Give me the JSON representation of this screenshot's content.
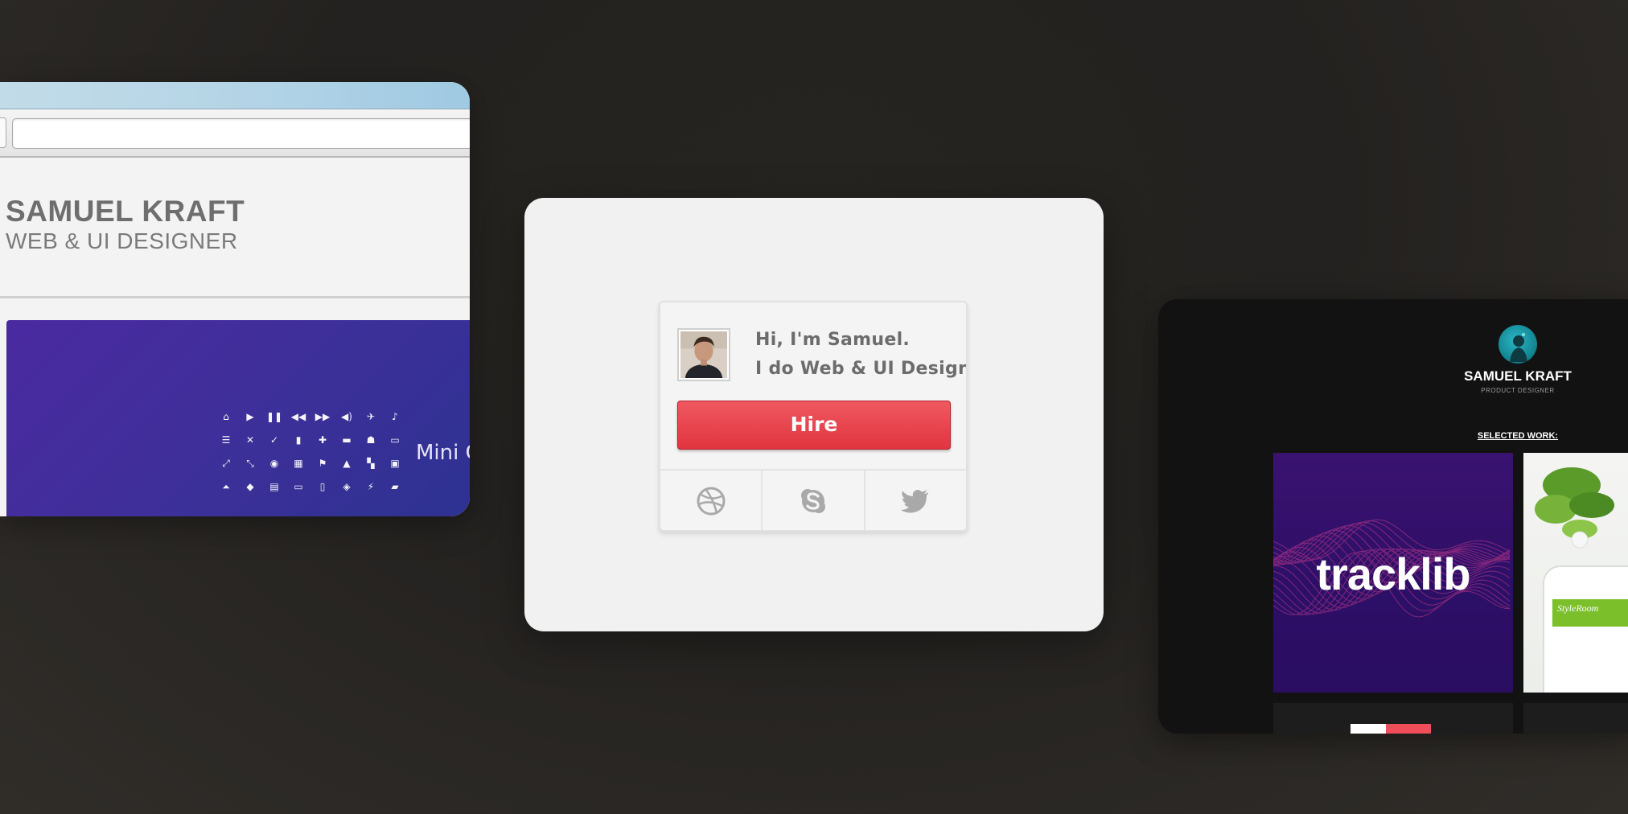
{
  "left_browser": {
    "name": "SAMUEL KRAFT",
    "role": "WEB & UI DESIGNER",
    "banner_label": "Mini G",
    "icons": [
      "⌂",
      "▶",
      "❚❚",
      "◀◀",
      "▶▶",
      "◀)",
      "✈",
      "♪",
      "☰",
      "✕",
      "✓",
      "▮",
      "✚",
      "▬",
      "☗",
      "▭",
      "⤢",
      "⤡",
      "◉",
      "▦",
      "⚑",
      "▲",
      "▚",
      "▣",
      "⏶",
      "◆",
      "▤",
      "▭",
      "▯",
      "◈",
      "⚡",
      "▰"
    ]
  },
  "widget": {
    "greeting_line1": "Hi, I'm Samuel.",
    "greeting_line2": "I do Web & UI Design.",
    "hire_label": "Hire",
    "social": [
      "dribbble-icon",
      "skype-icon",
      "twitter-icon"
    ],
    "colors": {
      "hire": "#e63d47",
      "icon": "#a9a9a9"
    }
  },
  "right_site": {
    "name": "SAMUEL KRAFT",
    "subtitle": "PRODUCT DESIGNER",
    "section_title": "SELECTED WORK:",
    "tile_1_wordmark": "tracklib",
    "tile_2_app": "StyleRoom"
  }
}
